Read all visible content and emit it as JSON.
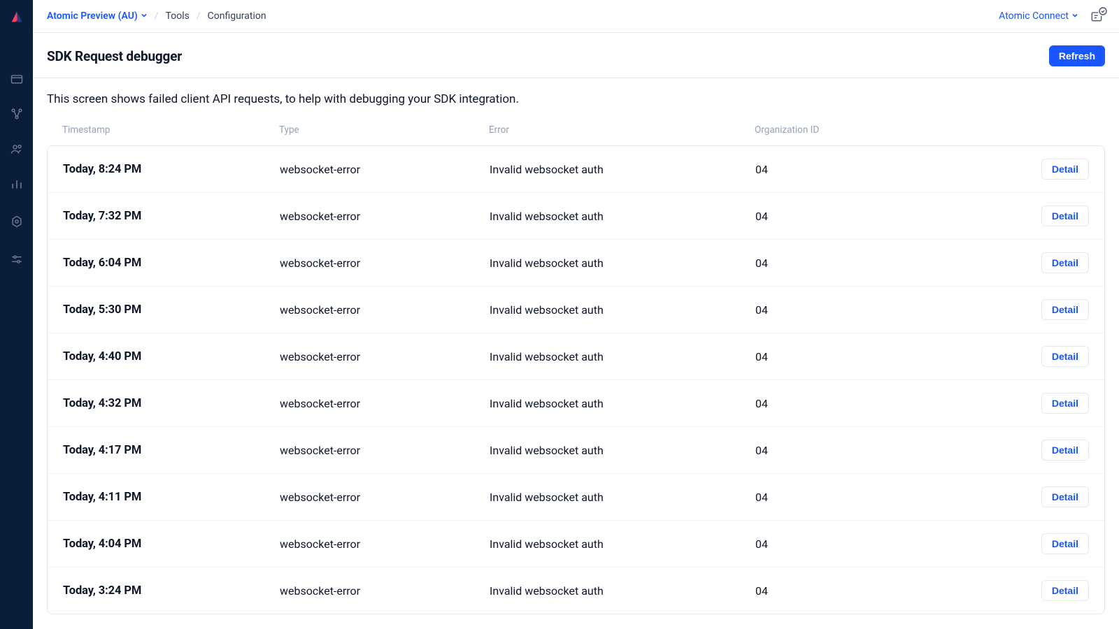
{
  "sidebar": {
    "items": [
      {
        "name": "cards"
      },
      {
        "name": "actions"
      },
      {
        "name": "users"
      },
      {
        "name": "analytics"
      },
      {
        "name": "settings"
      },
      {
        "name": "sliders"
      }
    ]
  },
  "topbar": {
    "env_label": "Atomic Preview (AU)",
    "crumb_tools": "Tools",
    "crumb_config": "Configuration",
    "account_label": "Atomic Connect"
  },
  "page": {
    "title": "SDK Request debugger",
    "refresh_label": "Refresh",
    "description": "This screen shows failed client API requests, to help with debugging your SDK integration."
  },
  "table": {
    "headers": {
      "timestamp": "Timestamp",
      "type": "Type",
      "error": "Error",
      "org": "Organization ID"
    },
    "detail_label": "Detail",
    "rows": [
      {
        "timestamp": "Today, 8:24 PM",
        "type": "websocket-error",
        "error": "Invalid websocket auth",
        "org": "04"
      },
      {
        "timestamp": "Today, 7:32 PM",
        "type": "websocket-error",
        "error": "Invalid websocket auth",
        "org": "04"
      },
      {
        "timestamp": "Today, 6:04 PM",
        "type": "websocket-error",
        "error": "Invalid websocket auth",
        "org": "04"
      },
      {
        "timestamp": "Today, 5:30 PM",
        "type": "websocket-error",
        "error": "Invalid websocket auth",
        "org": "04"
      },
      {
        "timestamp": "Today, 4:40 PM",
        "type": "websocket-error",
        "error": "Invalid websocket auth",
        "org": "04"
      },
      {
        "timestamp": "Today, 4:32 PM",
        "type": "websocket-error",
        "error": "Invalid websocket auth",
        "org": "04"
      },
      {
        "timestamp": "Today, 4:17 PM",
        "type": "websocket-error",
        "error": "Invalid websocket auth",
        "org": "04"
      },
      {
        "timestamp": "Today, 4:11 PM",
        "type": "websocket-error",
        "error": "Invalid websocket auth",
        "org": "04"
      },
      {
        "timestamp": "Today, 4:04 PM",
        "type": "websocket-error",
        "error": "Invalid websocket auth",
        "org": "04"
      },
      {
        "timestamp": "Today, 3:24 PM",
        "type": "websocket-error",
        "error": "Invalid websocket auth",
        "org": "04"
      }
    ]
  }
}
